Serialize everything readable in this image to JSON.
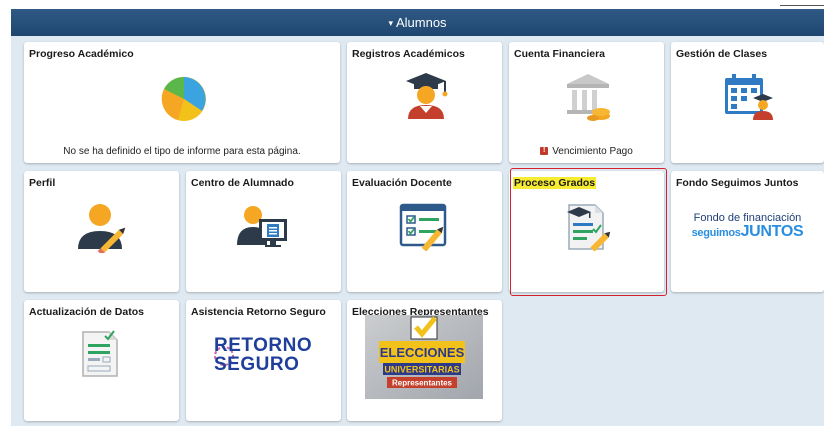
{
  "header": {
    "title": "Alumnos",
    "arrow_glyph": "▾"
  },
  "tiles": {
    "progreso": {
      "title": "Progreso Académico",
      "note": "No se ha definido el tipo de informe para esta página.",
      "icon": "pie-chart-icon"
    },
    "registros": {
      "title": "Registros Académicos",
      "icon": "graduate-student-icon"
    },
    "cuenta": {
      "title": "Cuenta Financiera",
      "note": "Vencimiento Pago",
      "alert_glyph": "!",
      "icon": "bank-icon"
    },
    "gestion": {
      "title": "Gestión de Clases",
      "icon": "calendar-student-icon"
    },
    "perfil": {
      "title": "Perfil",
      "icon": "user-edit-icon"
    },
    "centro": {
      "title": "Centro de Alumnado",
      "icon": "student-center-icon"
    },
    "evaluacion": {
      "title": "Evaluación Docente",
      "icon": "evaluation-form-icon"
    },
    "proceso": {
      "title": "Proceso Grados",
      "icon": "graduation-document-icon"
    },
    "fondo": {
      "title": "Fondo Seguimos Juntos",
      "logo_line1": "Fondo de financiación",
      "logo_line2a": "seguimos",
      "logo_line2b": "JUNTOS"
    },
    "actualizacion": {
      "title": "Actualización de Datos",
      "icon": "data-form-icon"
    },
    "asistencia": {
      "title": "Asistencia Retorno Seguro",
      "logo_line1": "RETORNO",
      "logo_line2": "SEGURO"
    },
    "elecciones": {
      "title": "Elecciones Representantes",
      "banner_line1": "ELECCIONES",
      "banner_line2": "UNIVERSITARIAS",
      "banner_line3": "Representantes"
    }
  },
  "colors": {
    "header": "#244f7b",
    "canvas": "#dfe9f2",
    "highlight": "#f7ec31",
    "selection_frame": "#d5202e"
  }
}
